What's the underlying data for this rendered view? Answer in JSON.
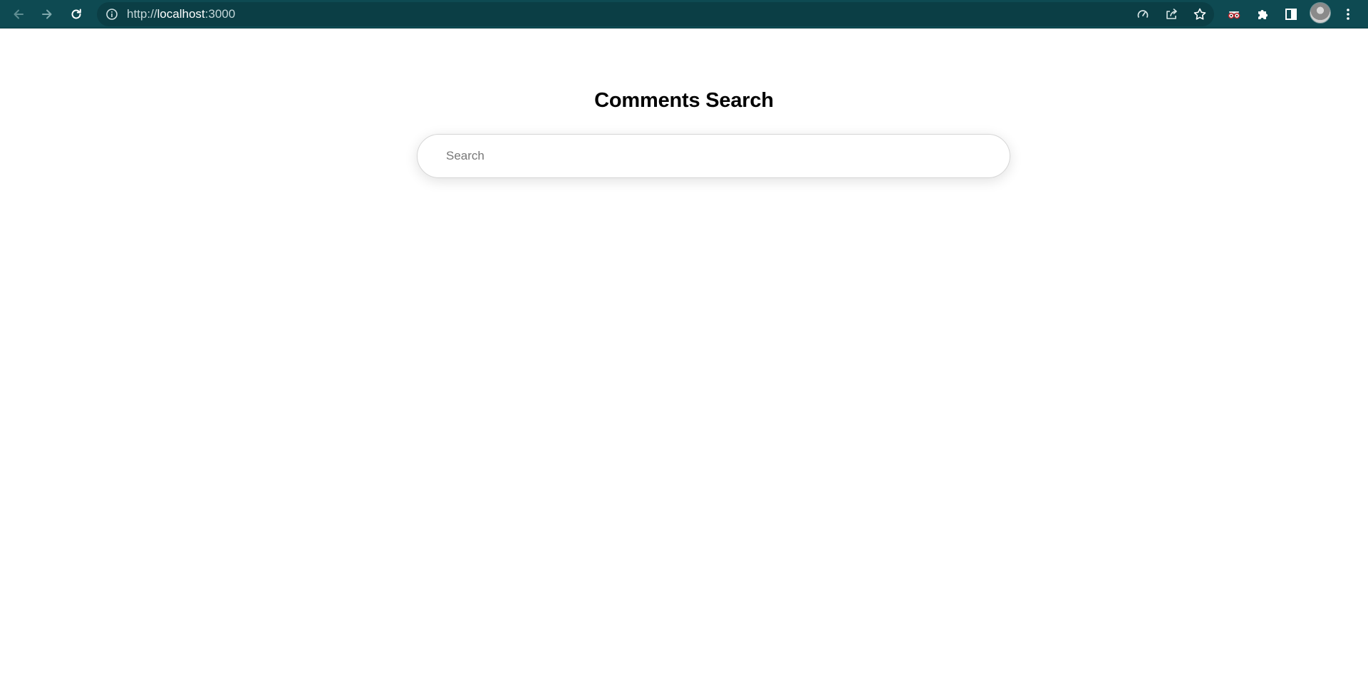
{
  "browser": {
    "url_scheme": "http://",
    "url_host": "localhost",
    "url_port": ":3000",
    "toolbar_color": "#0e4a52",
    "icons": {
      "back": "back-arrow-icon",
      "forward": "forward-arrow-icon",
      "reload": "reload-icon",
      "site_info": "info-icon",
      "performance": "speedometer-icon",
      "share": "share-icon",
      "bookmark": "star-icon",
      "extension_1": "spy-glasses-icon",
      "extensions": "puzzle-icon",
      "side_panel": "side-panel-icon",
      "profile": "avatar",
      "menu": "kebab-menu-icon"
    }
  },
  "page": {
    "title": "Comments Search",
    "search": {
      "placeholder": "Search",
      "value": ""
    }
  }
}
